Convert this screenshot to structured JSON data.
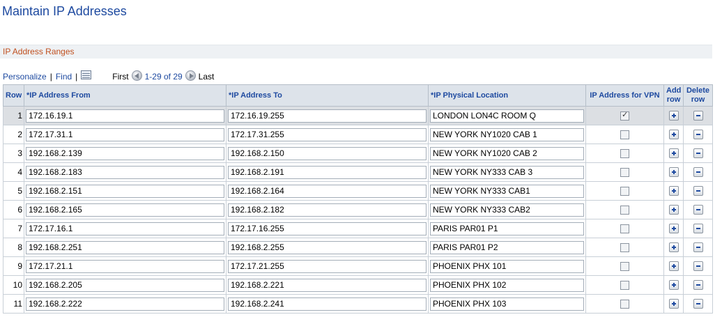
{
  "page": {
    "title": "Maintain IP Addresses",
    "section_title": "IP Address Ranges"
  },
  "grid_nav": {
    "personalize": "Personalize",
    "find": "Find",
    "grid_icon": "view-all-grid-icon",
    "first": "First",
    "range": "1-29 of 29",
    "last": "Last"
  },
  "columns": {
    "row": "Row",
    "from": "*IP Address From",
    "to": "*IP Address To",
    "location": "*IP Physical Location",
    "vpn": "IP Address for VPN",
    "add_row": "Add row",
    "delete_row": "Delete row"
  },
  "rows": [
    {
      "num": "1",
      "from": "172.16.19.1",
      "to": "172.16.19.255",
      "location": "LONDON LON4C ROOM Q",
      "vpn": true
    },
    {
      "num": "2",
      "from": "172.17.31.1",
      "to": "172.17.31.255",
      "location": "NEW YORK NY1020 CAB 1",
      "vpn": false
    },
    {
      "num": "3",
      "from": "192.168.2.139",
      "to": "192.168.2.150",
      "location": "NEW YORK NY1020 CAB 2",
      "vpn": false
    },
    {
      "num": "4",
      "from": "192.168.2.183",
      "to": "192.168.2.191",
      "location": "NEW YORK NY333 CAB 3",
      "vpn": false
    },
    {
      "num": "5",
      "from": "192.168.2.151",
      "to": "192.168.2.164",
      "location": "NEW YORK NY333 CAB1",
      "vpn": false
    },
    {
      "num": "6",
      "from": "192.168.2.165",
      "to": "192.168.2.182",
      "location": "NEW YORK NY333 CAB2",
      "vpn": false
    },
    {
      "num": "7",
      "from": "172.17.16.1",
      "to": "172.17.16.255",
      "location": "PARIS PAR01 P1",
      "vpn": false
    },
    {
      "num": "8",
      "from": "192.168.2.251",
      "to": "192.168.2.255",
      "location": "PARIS PAR01 P2",
      "vpn": false
    },
    {
      "num": "9",
      "from": "172.17.21.1",
      "to": "172.17.21.255",
      "location": "PHOENIX PHX 101",
      "vpn": false
    },
    {
      "num": "10",
      "from": "192.168.2.205",
      "to": "192.168.2.221",
      "location": "PHOENIX PHX 102",
      "vpn": false
    },
    {
      "num": "11",
      "from": "192.168.2.222",
      "to": "192.168.2.241",
      "location": "PHOENIX PHX 103",
      "vpn": false
    }
  ],
  "colors": {
    "title_blue": "#1e4aa0",
    "section_orange": "#c0501f",
    "header_bg": "#dde3ea",
    "selected_row_bg": "#dcdfe3"
  }
}
